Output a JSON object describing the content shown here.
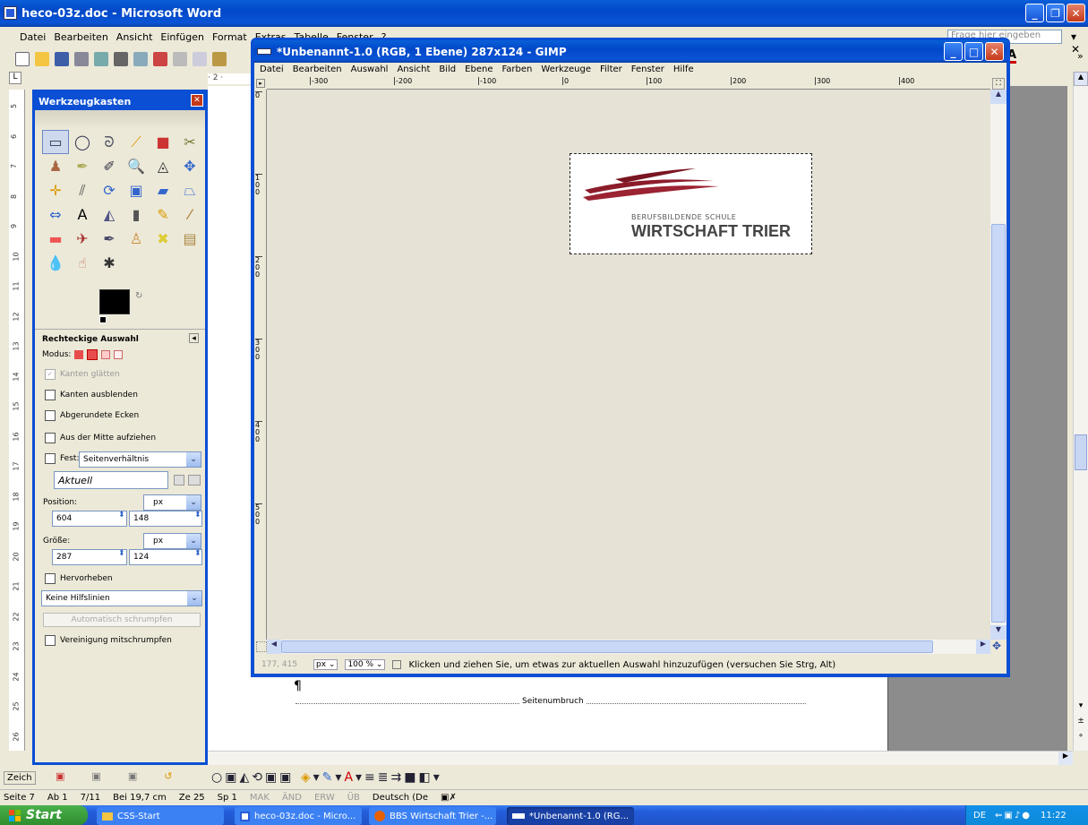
{
  "word": {
    "title": "heco-03z.doc - Microsoft Word",
    "menu": [
      "Datei",
      "Bearbeiten",
      "Ansicht",
      "Einfügen",
      "Format",
      "Extras",
      "Tabelle",
      "Fenster",
      "?"
    ],
    "help_placeholder": "Frage hier eingeben",
    "ruler_label": "· 2 ·",
    "vruler": [
      "5",
      "6",
      "7",
      "8",
      "9",
      "10",
      "11",
      "12",
      "13",
      "14",
      "15",
      "16",
      "17",
      "18",
      "19",
      "20",
      "21",
      "22",
      "23",
      "24",
      "25",
      "26"
    ],
    "pilcrow": "¶",
    "page_break": "Seitenumbruch",
    "drawing_label": "Zeich",
    "status": {
      "page": "Seite 7",
      "ab": "Ab 1",
      "pages": "7/11",
      "at": "Bei 19,7 cm",
      "line": "Ze 25",
      "col": "Sp 1",
      "mak": "MAK",
      "aend": "ÄND",
      "erw": "ERW",
      "ueb": "ÜB",
      "lang": "Deutsch (De"
    }
  },
  "gimp": {
    "title": "*Unbenannt-1.0 (RGB, 1 Ebene) 287x124 - GIMP",
    "menu": [
      "Datei",
      "Bearbeiten",
      "Auswahl",
      "Ansicht",
      "Bild",
      "Ebene",
      "Farben",
      "Werkzeuge",
      "Filter",
      "Fenster",
      "Hilfe"
    ],
    "hruler": [
      "-300",
      "-200",
      "-100",
      "0",
      "100",
      "200",
      "300",
      "400"
    ],
    "vruler": [
      "0",
      "100",
      "200",
      "300",
      "400",
      "500"
    ],
    "logo": {
      "line1": "BERUFSBILDENDE SCHULE",
      "line2": "WIRTSCHAFT TRIER"
    },
    "coords": "177, 415",
    "unit": "px",
    "zoom": "100 %",
    "hint": "Klicken und ziehen Sie, um etwas zur aktuellen Auswahl hinzuzufügen (versuchen Sie Strg, Alt)"
  },
  "toolbox": {
    "title": "Werkzeugkasten",
    "options_title": "Rechteckige Auswahl",
    "modus": "Modus:",
    "kanten_glaetten": "Kanten glätten",
    "kanten_ausblenden": "Kanten ausblenden",
    "abgerundete": "Abgerundete Ecken",
    "aus_mitte": "Aus der Mitte aufziehen",
    "fest": "Fest:",
    "fest_value": "Seitenverhältnis",
    "aktuell": "Aktuell",
    "position_label": "Position:",
    "position_unit": "px",
    "pos_x": "604",
    "pos_y": "148",
    "size_label": "Größe:",
    "size_unit": "px",
    "size_w": "287",
    "size_h": "124",
    "hervorheben": "Hervorheben",
    "hilfslinien": "Keine Hilfslinien",
    "auto_shrink": "Automatisch schrumpfen",
    "vereinigung": "Vereinigung mitschrumpfen"
  },
  "taskbar": {
    "start": "Start",
    "items": [
      "CSS-Start",
      "heco-03z.doc - Micro...",
      "BBS Wirtschaft Trier -...",
      "*Unbenannt-1.0 (RG..."
    ],
    "lang": "DE",
    "clock": "11:22"
  }
}
